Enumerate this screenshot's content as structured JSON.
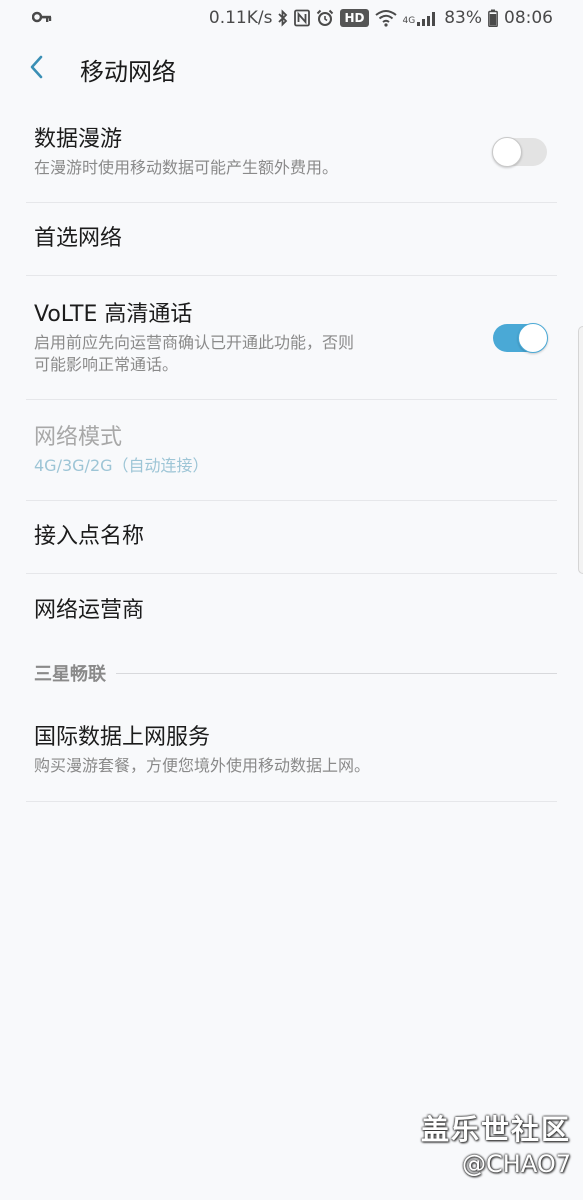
{
  "status_bar": {
    "speed": "0.11K/s",
    "hd": "HD",
    "network": "4G",
    "battery": "83%",
    "time": "08:06"
  },
  "header": {
    "title": "移动网络"
  },
  "rows": {
    "roaming": {
      "title": "数据漫游",
      "sub": "在漫游时使用移动数据可能产生额外费用。",
      "enabled": false
    },
    "preferred": {
      "title": "首选网络"
    },
    "volte": {
      "title": "VoLTE 高清通话",
      "sub_line1": "启用前应先向运营商确认已开通此功能，否则",
      "sub_line2": "可能影响正常通话。",
      "enabled": true
    },
    "mode": {
      "title": "网络模式",
      "sub": "4G/3G/2G（自动连接）"
    },
    "apn": {
      "title": "接入点名称"
    },
    "operator": {
      "title": "网络运营商"
    }
  },
  "section": {
    "label": "三星畅联"
  },
  "intl": {
    "title": "国际数据上网服务",
    "sub": "购买漫游套餐，方便您境外使用移动数据上网。"
  },
  "watermark": {
    "line1": "盖乐世社区",
    "line2": "@CHAO7"
  },
  "colors": {
    "accent": "#4aa9d6",
    "background": "#f8f9fb",
    "disabled_sub": "#9dc5d6"
  }
}
